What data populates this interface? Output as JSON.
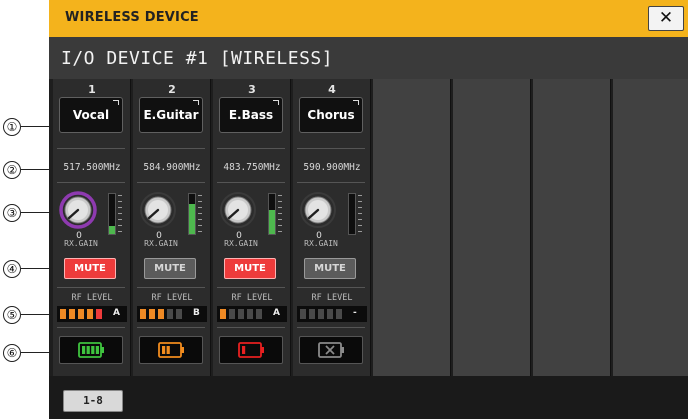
{
  "window": {
    "title": "WIRELESS DEVICE",
    "close_label": "✕"
  },
  "header": {
    "title": "I/O DEVICE #1 [WIRELESS]"
  },
  "callouts": [
    "①",
    "②",
    "③",
    "④",
    "⑤",
    "⑥"
  ],
  "channels": [
    {
      "number": "1",
      "name": "Vocal",
      "frequency": "517.500MHz",
      "gain_value": "0",
      "gain_label": "RX.GAIN",
      "gain_meter_level": 0.2,
      "mute_label": "MUTE",
      "mute_on": true,
      "rf_label": "RF LEVEL",
      "rf_level": 5,
      "antenna": "A",
      "battery_level": 4,
      "battery_status": "full"
    },
    {
      "number": "2",
      "name": "E.Guitar",
      "frequency": "584.900MHz",
      "gain_value": "0",
      "gain_label": "RX.GAIN",
      "gain_meter_level": 0.75,
      "mute_label": "MUTE",
      "mute_on": false,
      "rf_label": "RF LEVEL",
      "rf_level": 3,
      "antenna": "B",
      "battery_level": 2,
      "battery_status": "half"
    },
    {
      "number": "3",
      "name": "E.Bass",
      "frequency": "483.750MHz",
      "gain_value": "0",
      "gain_label": "RX.GAIN",
      "gain_meter_level": 0.6,
      "mute_label": "MUTE",
      "mute_on": true,
      "rf_label": "RF LEVEL",
      "rf_level": 1,
      "antenna": "A",
      "battery_level": 1,
      "battery_status": "low"
    },
    {
      "number": "4",
      "name": "Chorus",
      "frequency": "590.900MHz",
      "gain_value": "0",
      "gain_label": "RX.GAIN",
      "gain_meter_level": 0.0,
      "mute_label": "MUTE",
      "mute_on": false,
      "rf_label": "RF LEVEL",
      "rf_level": 0,
      "antenna": "-",
      "battery_level": 0,
      "battery_status": "none"
    }
  ],
  "footer": {
    "page_button": "1-8"
  },
  "colors": {
    "title_bar": "#f4b31c",
    "mute_on": "#ee3b3b",
    "rf_on": "#f08a24",
    "rf_off": "#4a4a4a",
    "battery_full": "#3fc43f",
    "battery_half": "#f28c1e",
    "battery_low": "#e82020",
    "gain_ring": "#8e3ab0"
  }
}
